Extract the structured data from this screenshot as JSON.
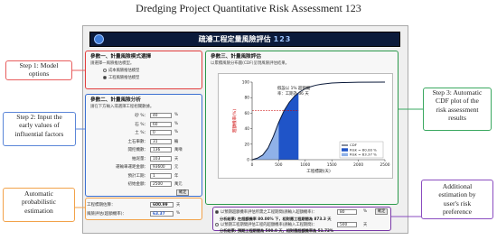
{
  "figure_title": "Dredging Project Quantitative Risk Assessment 123",
  "app": {
    "title": "疏濬工程定量風險評估",
    "version": "123"
  },
  "step1": {
    "title": "參數一、計量風險模式選擇",
    "desc": "請選擇一風險推估模型。",
    "options": [
      "成本風險推估模型",
      "工程風險推估模型"
    ],
    "selected_index": 1
  },
  "step2": {
    "title": "參數二、計量風險分析",
    "desc": "請在下方輸入或選擇工程相關數據。",
    "fields": [
      {
        "label": "砂 %：",
        "value": "40",
        "unit": "%"
      },
      {
        "label": "石 %：",
        "value": "60",
        "unit": "%"
      },
      {
        "label": "土 %：",
        "value": "0",
        "unit": "%"
      },
      {
        "label": "土石車數：",
        "value": "31",
        "unit": "輛"
      },
      {
        "label": "開挖機數：",
        "value": "136",
        "unit": "萬噸"
      },
      {
        "label": "抽泥量：",
        "value": "103",
        "unit": "天"
      },
      {
        "label": "運輸車運距金額：",
        "value": "93600",
        "unit": "元"
      },
      {
        "label": "預計工期：",
        "value": "1",
        "unit": "年"
      },
      {
        "label": "初始金額：",
        "value": "2500",
        "unit": "萬元"
      }
    ],
    "confirm_label": "確定"
  },
  "estimation": {
    "duration_label": "工程標期估算：",
    "duration_value": "600.99",
    "duration_unit": "天",
    "risk_label": "風險評估(超額機率)：",
    "risk_value": "63.37",
    "risk_unit": "%"
  },
  "step3": {
    "title": "參數三、計量風險評估",
    "desc": "以累積風險分布圖(CDF)呈現風險評估結果。"
  },
  "chart_data": {
    "type": "area",
    "xlabel": "工程標期(天)",
    "ylabel": "超額機率(%)",
    "xlim": [
      0,
      2500
    ],
    "ylim": [
      0,
      100
    ],
    "xticks": [
      0,
      500,
      1000,
      1500,
      2000,
      2500
    ],
    "yticks": [
      0,
      20,
      40,
      60,
      80,
      100
    ],
    "x": [
      0,
      100,
      200,
      300,
      400,
      500,
      600,
      700,
      800,
      900,
      1000,
      1100,
      1200,
      1300,
      1500,
      1700,
      2000,
      2500
    ],
    "y": [
      0,
      2,
      6,
      15,
      30,
      48,
      63,
      74,
      82,
      87.5,
      91.5,
      94,
      96,
      97.3,
      98.8,
      99.4,
      99.8,
      100
    ],
    "annotation": "假設以 1% 超額機率：工期為 36 天",
    "ref_line": {
      "y": 63.37
    },
    "legend_position": "bottom-right",
    "legend": [
      {
        "name": "CDF",
        "color": "#0b1a3a"
      },
      {
        "name": "Risk = 80.00 %",
        "color": "#1f54c8"
      },
      {
        "name": "Risk = 63.37 %",
        "color": "#8fb1e8"
      }
    ],
    "shaded": [
      {
        "from": 0,
        "to": 500,
        "color": "#8fb1e8"
      },
      {
        "from": 500,
        "to": 873,
        "color": "#1f54c8"
      }
    ]
  },
  "additional": {
    "row1_option": "以預期超額機率評估所需之工程期間(請輸入超額機率)：",
    "row1_value": "80",
    "row1_unit": "%",
    "row1_result": "分析結果: 在超額機率 80.00% 下，相對應工程期間為 873.3 天",
    "row2_option": "以預期工程期間評估工程的超額機率(請輸入工程期間)：",
    "row2_value": "500",
    "row2_unit": "天",
    "row2_result": "分析結果: 預期工程期間為 500.0 天，相對應超額機率為 51.72%",
    "confirm_label": "確定"
  },
  "annotations": {
    "step1": "Step 1: Model\noptions",
    "step2": "Step 2: Input the\nearly values of\ninfluential factors",
    "step3": "Step 3: Automatic\nCDF plot of the\nrisk assessment\nresults",
    "auto": "Automatic\nprobabilistic\nestimation",
    "additional": "Additional\nestimation by\nuser's risk\npreference"
  }
}
